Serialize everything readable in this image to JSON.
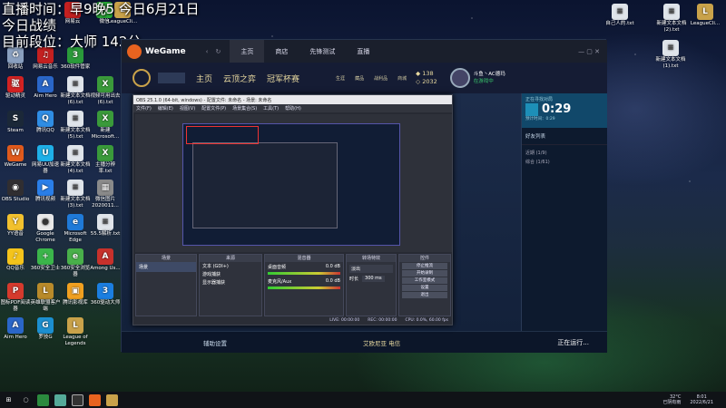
{
  "overlay": {
    "line1": "直播时间：早9晚5  今日6月21日",
    "line2": "今日战绩",
    "line3": "目前段位：大师 142分"
  },
  "desktop": {
    "left_icons": [
      {
        "label": "回收站",
        "color": "#8aa0c0",
        "glyph": "♻"
      },
      {
        "label": "网易云音乐",
        "color": "#c42020",
        "glyph": "♫"
      },
      {
        "label": "360软件管家",
        "color": "#2a9a3a",
        "glyph": "3"
      },
      {
        "label": "驱动精灵",
        "color": "#d32222",
        "glyph": "驱"
      },
      {
        "label": "Aim Hero",
        "color": "#2a66c8",
        "glyph": "A"
      },
      {
        "label": "新建文本文档 (6).txt",
        "color": "#dfe4ea",
        "glyph": "≡"
      },
      {
        "label": "视频可用出去(6).txt",
        "color": "#3a9a3a",
        "glyph": "X"
      },
      {
        "label": "Steam",
        "color": "#1b2838",
        "glyph": "S"
      },
      {
        "label": "腾讯QQ",
        "color": "#2f8de4",
        "glyph": "Q"
      },
      {
        "label": "新建文本文档(5).txt",
        "color": "#dfe4ea",
        "glyph": "≡"
      },
      {
        "label": "新建 Microsoft...",
        "color": "#3a9a3a",
        "glyph": "X"
      },
      {
        "label": "WeGame",
        "color": "#e05a1c",
        "glyph": "W"
      },
      {
        "label": "网易UU加速器",
        "color": "#1fb0e8",
        "glyph": "U"
      },
      {
        "label": "新建文本文档 (4).txt",
        "color": "#dfe4ea",
        "glyph": "≡"
      },
      {
        "label": "主播分辨率.txt",
        "color": "#3a9a3a",
        "glyph": "X"
      },
      {
        "label": "OBS Studio",
        "color": "#302e31",
        "glyph": "◉"
      },
      {
        "label": "腾讯视频",
        "color": "#2a7ee8",
        "glyph": "▶"
      },
      {
        "label": "新建文本文档 (3).txt",
        "color": "#dfe4ea",
        "glyph": "≡"
      },
      {
        "label": "微信图片 2020011...",
        "color": "#8a8a8a",
        "glyph": "▦"
      },
      {
        "label": "YY语音",
        "color": "#f2c12e",
        "glyph": "Y"
      },
      {
        "label": "Google Chrome",
        "color": "#e8e8e8",
        "glyph": "●"
      },
      {
        "label": "Microsoft Edge",
        "color": "#1f7ad8",
        "glyph": "e"
      },
      {
        "label": "55.5解析.txt",
        "color": "#dfe4ea",
        "glyph": "≡"
      },
      {
        "label": "QQ音乐",
        "color": "#f4c41b",
        "glyph": "♪"
      },
      {
        "label": "360安全卫士",
        "color": "#3bb54a",
        "glyph": "+"
      },
      {
        "label": "360安全浏览器",
        "color": "#49b04a",
        "glyph": "e"
      },
      {
        "label": "Among Us...",
        "color": "#c7312b",
        "glyph": "A"
      },
      {
        "label": "图标PDF阅读器",
        "color": "#d53a2d",
        "glyph": "P"
      },
      {
        "label": "英雄联盟客户端",
        "color": "#b88a2a",
        "glyph": "L"
      },
      {
        "label": "腾讯影视库",
        "color": "#f0a020",
        "glyph": "▣"
      },
      {
        "label": "360驱动大师",
        "color": "#1b7ee0",
        "glyph": "3"
      },
      {
        "label": "Aim Hero",
        "color": "#2a66c8",
        "glyph": "A"
      },
      {
        "label": "罗技G",
        "color": "#1c8fd0",
        "glyph": "G"
      },
      {
        "label": "League of Legends",
        "color": "#c9a24a",
        "glyph": "L"
      }
    ],
    "top_icons": [
      {
        "label": "网易云",
        "color": "#c42020",
        "glyph": "♫"
      },
      {
        "label": "微信",
        "color": "#2aae3a",
        "glyph": "W"
      },
      {
        "label": "LeagueCli...",
        "color": "#c9a24a",
        "glyph": "L"
      }
    ],
    "right_icons": [
      {
        "label": "新建文本文档(2).txt",
        "color": "#dfe4ea",
        "glyph": "≡"
      },
      {
        "label": "LeagueCli...",
        "color": "#c9a24a",
        "glyph": "L"
      },
      {
        "label": "新建文本文档(1).txt",
        "color": "#dfe4ea",
        "glyph": "≡"
      },
      {
        "label": "自己人的.txt",
        "color": "#dfe4ea",
        "glyph": "≡"
      }
    ]
  },
  "wegame": {
    "app_name": "WeGame",
    "tabs": [
      "主页",
      "商店",
      "先锋测试",
      "直播"
    ],
    "lol_tabs": [
      "主页",
      "云顶之弈",
      "冠军杯赛"
    ],
    "nav_icons": [
      "生涯",
      "藏品",
      "战利品",
      "商城"
    ],
    "currency_top": "138",
    "currency_bottom": "2032",
    "profile_name": "斗鱼丶AC德玛",
    "profile_status": "在游戏中",
    "queue_label": "正在寻找对局",
    "queue_timer": "0:29",
    "queue_sub": "预计时间：0:29",
    "friends_header": "好友列表",
    "friend_groups": [
      "近期 (1/9)",
      "综合 (1/61)"
    ],
    "status_bar": [
      "辅助设置",
      "艾欧尼亚 电信",
      "正在运行..."
    ]
  },
  "obs": {
    "title": "OBS 25.1.0 (64-bit, windows) - 配置文件: 未命名 - 场景: 未命名",
    "menu": [
      "文件(F)",
      "编辑(E)",
      "视图(V)",
      "配置文件(P)",
      "场景集合(S)",
      "工具(T)",
      "帮助(H)"
    ],
    "docks": {
      "scenes_title": "场景",
      "scenes": [
        "场景"
      ],
      "sources_title": "来源",
      "sources": [
        "文本 (GDI+)",
        "游戏捕获",
        "显示器捕获"
      ],
      "mixer_title": "混音器",
      "mixer_tracks": [
        "桌面音频",
        "麦克风/Aux"
      ],
      "mixer_db": [
        "0.0 dB",
        "0.0 dB"
      ],
      "transitions_title": "转场特效",
      "transition": "淡出",
      "duration_label": "时长",
      "duration": "300 ms",
      "controls_title": "控件",
      "controls": [
        "停止推流",
        "开始录制",
        "工作室模式",
        "设置",
        "退出"
      ]
    },
    "status": [
      "LIVE: 00:00:00",
      "REC: 00:00:00",
      "CPU: 0.0%, 60.00 fps"
    ]
  },
  "taskbar": {
    "time": "8:01",
    "date": "2022/6/21",
    "temp": "32°C",
    "weather": "已阴有雨"
  }
}
